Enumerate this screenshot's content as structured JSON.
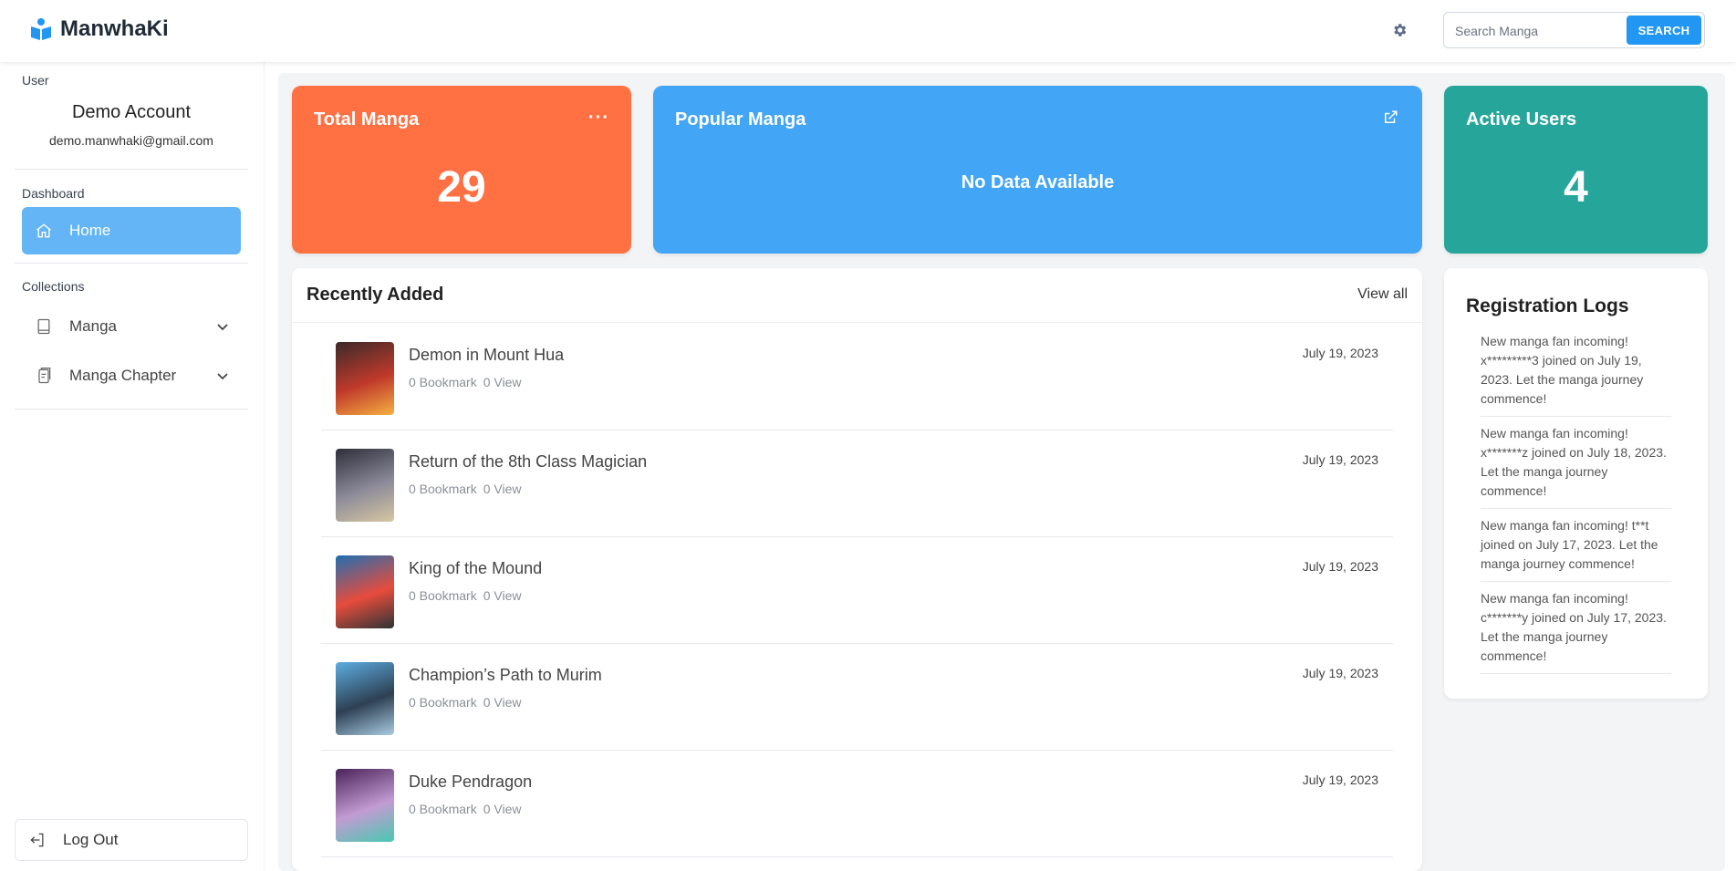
{
  "header": {
    "app_name": "ManwhaKi",
    "search": {
      "placeholder": "Search Manga",
      "button_label": "SEARCH"
    }
  },
  "sidebar": {
    "user_section_label": "User",
    "user_name": "Demo Account",
    "user_email": "demo.manwhaki@gmail.com",
    "dashboard_label": "Dashboard",
    "home_label": "Home",
    "collections_label": "Collections",
    "collections": [
      {
        "label": "Manga"
      },
      {
        "label": "Manga Chapter"
      }
    ],
    "logout_label": "Log Out"
  },
  "stats": {
    "total": {
      "title": "Total Manga",
      "value": "29",
      "menu": "···"
    },
    "popular": {
      "title": "Popular Manga",
      "empty": "No Data Available"
    },
    "active": {
      "title": "Active Users",
      "value": "4"
    }
  },
  "recent": {
    "title": "Recently Added",
    "view_all": "View all",
    "items": [
      {
        "title": "Demon in Mount Hua",
        "bookmark": "0 Bookmark",
        "views": "0 View",
        "date": "July 19, 2023",
        "colors": [
          "#3b2a2a",
          "#c0392b",
          "#f5b041"
        ]
      },
      {
        "title": "Return of the 8th Class Magician",
        "bookmark": "0 Bookmark",
        "views": "0 View",
        "date": "July 19, 2023",
        "colors": [
          "#2c2f3a",
          "#8d8b9a",
          "#d6c7a1"
        ]
      },
      {
        "title": "King of the Mound",
        "bookmark": "0 Bookmark",
        "views": "0 View",
        "date": "July 19, 2023",
        "colors": [
          "#1f6fb2",
          "#e74c3c",
          "#2d3436"
        ]
      },
      {
        "title": "Champion’s Path to Murim",
        "bookmark": "0 Bookmark",
        "views": "0 View",
        "date": "July 19, 2023",
        "colors": [
          "#5dade2",
          "#2e4053",
          "#a9cce3"
        ]
      },
      {
        "title": "Duke Pendragon",
        "bookmark": "0 Bookmark",
        "views": "0 View",
        "date": "July 19, 2023",
        "colors": [
          "#4a235a",
          "#c39bd3",
          "#48c9b0"
        ]
      }
    ]
  },
  "logs": {
    "title": "Registration Logs",
    "entries": [
      "New manga fan incoming! x*********3 joined on July 19, 2023. Let the manga journey commence!",
      "New manga fan incoming! x*******z joined on July 18, 2023. Let the manga journey commence!",
      "New manga fan incoming! t**t joined on July 17, 2023. Let the manga journey commence!",
      "New manga fan incoming! c*******y joined on July 17, 2023. Let the manga journey commence!"
    ]
  },
  "colors": {
    "accent": "#2196f3",
    "nav_active": "#64b5f6",
    "total_card": "#ff7043",
    "popular_card": "#42a5f5",
    "active_card": "#26a69a"
  }
}
